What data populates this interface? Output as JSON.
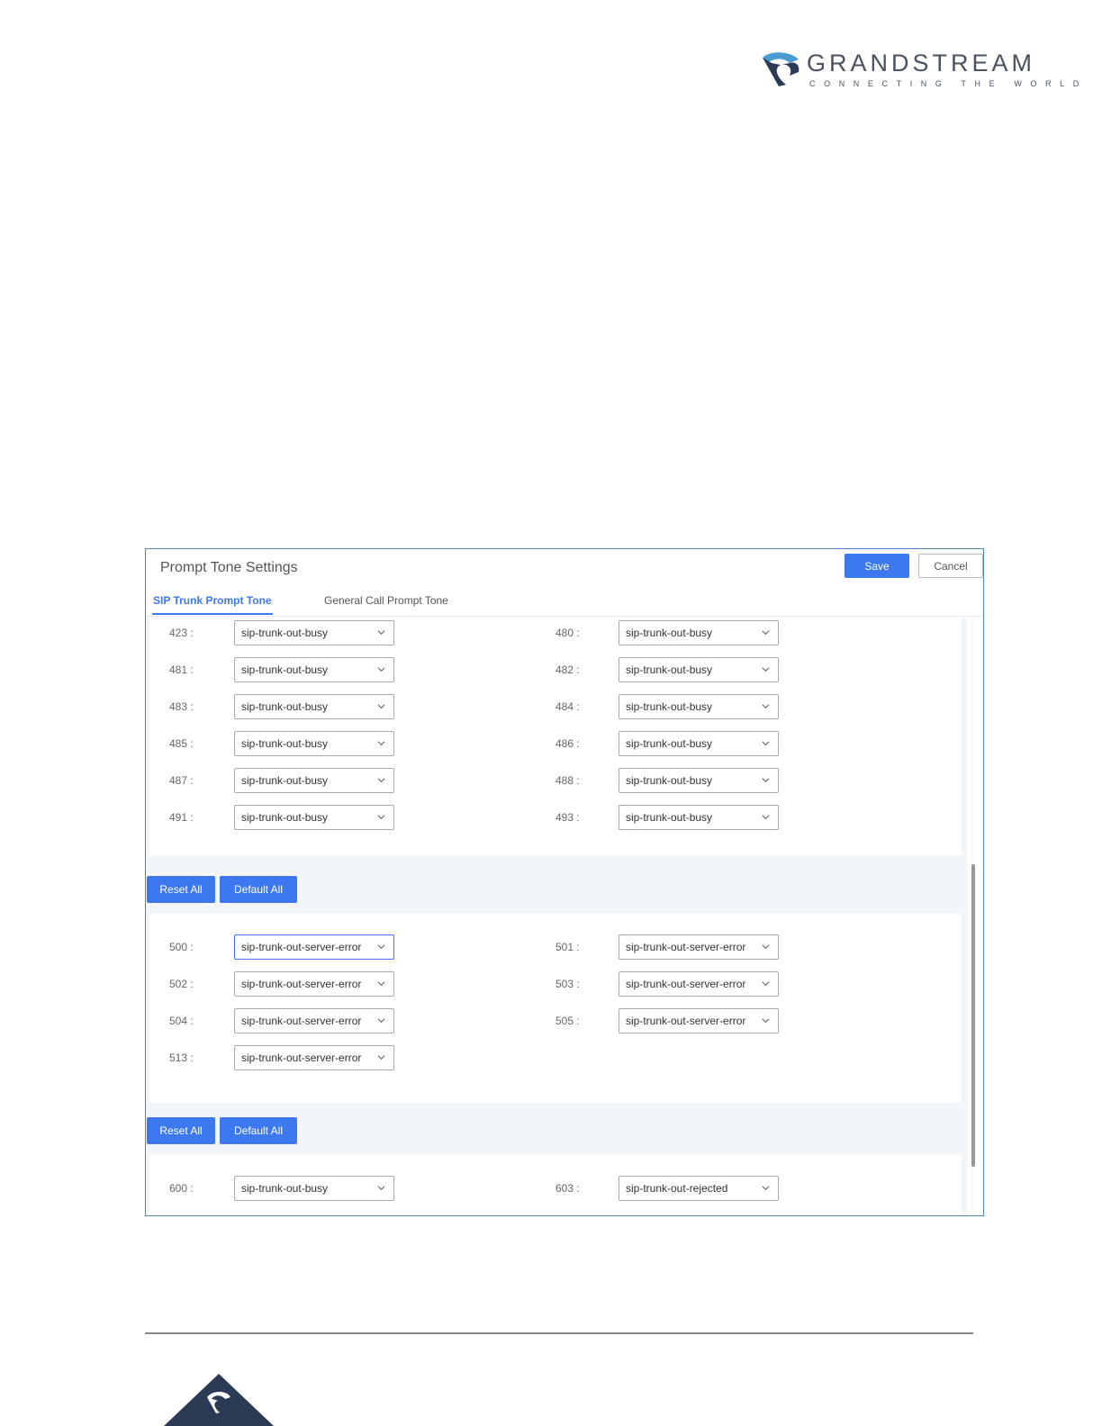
{
  "brand": {
    "name": "GRANDSTREAM",
    "tagline": "CONNECTING THE WORLD",
    "colors": {
      "dark": "#2b3a55",
      "accent": "#4a9bd1"
    }
  },
  "panel": {
    "title": "Prompt Tone Settings",
    "save_label": "Save",
    "cancel_label": "Cancel",
    "tabs": [
      {
        "label": "SIP Trunk Prompt Tone",
        "active": true
      },
      {
        "label": "General Call Prompt Tone",
        "active": false
      }
    ]
  },
  "group_4xx": {
    "left": [
      {
        "code": "423 :",
        "value": "sip-trunk-out-busy"
      },
      {
        "code": "481 :",
        "value": "sip-trunk-out-busy"
      },
      {
        "code": "483 :",
        "value": "sip-trunk-out-busy"
      },
      {
        "code": "485 :",
        "value": "sip-trunk-out-busy"
      },
      {
        "code": "487 :",
        "value": "sip-trunk-out-busy"
      },
      {
        "code": "491 :",
        "value": "sip-trunk-out-busy"
      }
    ],
    "right": [
      {
        "code": "480 :",
        "value": "sip-trunk-out-busy"
      },
      {
        "code": "482 :",
        "value": "sip-trunk-out-busy"
      },
      {
        "code": "484 :",
        "value": "sip-trunk-out-busy"
      },
      {
        "code": "486 :",
        "value": "sip-trunk-out-busy"
      },
      {
        "code": "488 :",
        "value": "sip-trunk-out-busy"
      },
      {
        "code": "493 :",
        "value": "sip-trunk-out-busy"
      }
    ]
  },
  "group_5xx": {
    "left": [
      {
        "code": "500 :",
        "value": "sip-trunk-out-server-error"
      },
      {
        "code": "502 :",
        "value": "sip-trunk-out-server-error"
      },
      {
        "code": "504 :",
        "value": "sip-trunk-out-server-error"
      },
      {
        "code": "513 :",
        "value": "sip-trunk-out-server-error"
      }
    ],
    "right": [
      {
        "code": "501 :",
        "value": "sip-trunk-out-server-error"
      },
      {
        "code": "503 :",
        "value": "sip-trunk-out-server-error"
      },
      {
        "code": "505 :",
        "value": "sip-trunk-out-server-error"
      }
    ]
  },
  "group_6xx": {
    "left": [
      {
        "code": "600 :",
        "value": "sip-trunk-out-busy"
      }
    ],
    "right": [
      {
        "code": "603 :",
        "value": "sip-trunk-out-rejected"
      }
    ]
  },
  "actions": {
    "reset_all": "Reset All",
    "default_all": "Default All"
  }
}
